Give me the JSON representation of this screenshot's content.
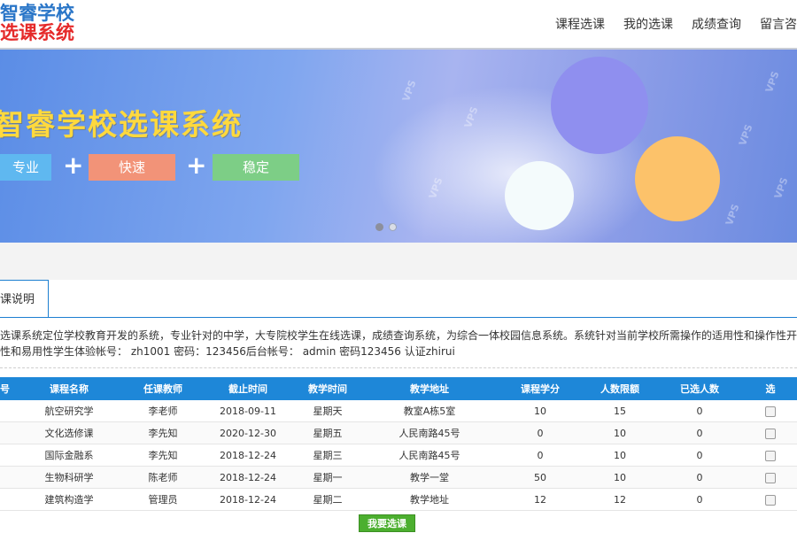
{
  "logo": {
    "line1": "智睿学校",
    "line2": "选课系统"
  },
  "nav": {
    "items": [
      "课程选课",
      "我的选课",
      "成绩查询",
      "留言咨"
    ]
  },
  "banner": {
    "title": "智睿学校选课系统",
    "tags": [
      "专业",
      "快速",
      "稳定"
    ],
    "plus": "+",
    "watermark": "VPS",
    "carousel": {
      "total": 2,
      "active": 1
    }
  },
  "tab": {
    "label": "课说明"
  },
  "description": {
    "line1": "选课系统定位学校教育开发的系统，专业针对的中学，大专院校学生在线选课，成绩查询系统，为综合一体校园信息系统。系统针对当前学校所需操作的适用性和操作性开发，增强",
    "line2": "性和易用性学生体验帐号： zh1001 密码：123456后台帐号： admin 密码123456 认证zhirui"
  },
  "table": {
    "headers": [
      "号",
      "课程名称",
      "任课教师",
      "截止时间",
      "教学时间",
      "教学地址",
      "课程学分",
      "人数限额",
      "已选人数",
      "选"
    ],
    "rows": [
      [
        "",
        "航空研究学",
        "李老师",
        "2018-09-11",
        "星期天",
        "教室A栋5室",
        "10",
        "15",
        "0"
      ],
      [
        "",
        "文化选修课",
        "李先知",
        "2020-12-30",
        "星期五",
        "人民南路45号",
        "0",
        "10",
        "0"
      ],
      [
        "",
        "国际金融系",
        "李先知",
        "2018-12-24",
        "星期三",
        "人民南路45号",
        "0",
        "10",
        "0"
      ],
      [
        "",
        "生物科研学",
        "陈老师",
        "2018-12-24",
        "星期一",
        "教学一堂",
        "50",
        "10",
        "0"
      ],
      [
        "",
        "建筑构造学",
        "管理员",
        "2018-12-24",
        "星期二",
        "教学地址",
        "12",
        "12",
        "0"
      ]
    ]
  },
  "submit_label": "我要选课",
  "colors": {
    "accent": "#1e87d8",
    "title": "#ffd93d",
    "submit": "#4caf2f"
  }
}
